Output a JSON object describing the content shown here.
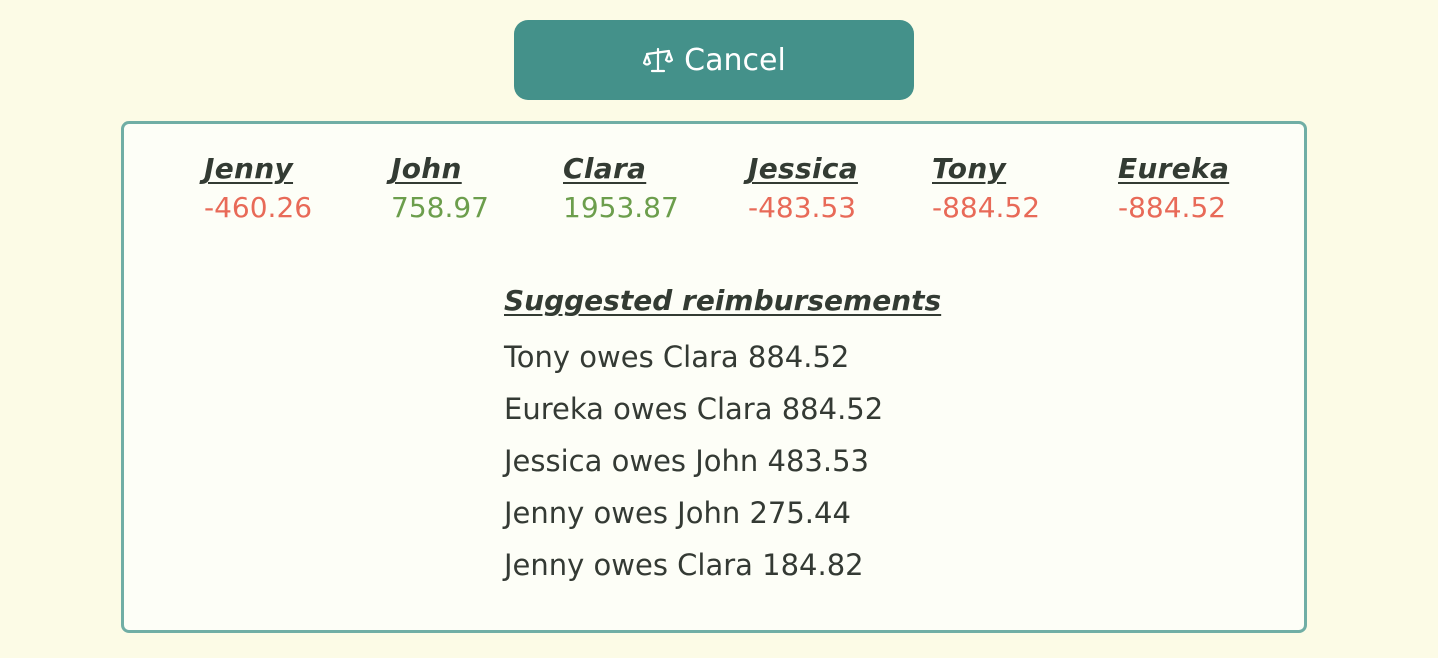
{
  "cancel_button": {
    "label": "Cancel",
    "icon": "balance-scale-icon"
  },
  "balances": [
    {
      "name": "Jenny",
      "amount": "-460.26",
      "sign": "negative"
    },
    {
      "name": "John",
      "amount": "758.97",
      "sign": "positive"
    },
    {
      "name": "Clara",
      "amount": "1953.87",
      "sign": "positive"
    },
    {
      "name": "Jessica",
      "amount": "-483.53",
      "sign": "negative"
    },
    {
      "name": "Tony",
      "amount": "-884.52",
      "sign": "negative"
    },
    {
      "name": "Eureka",
      "amount": "-884.52",
      "sign": "negative"
    }
  ],
  "reimbursements": {
    "heading": "Suggested reimbursements",
    "items": [
      "Tony owes Clara 884.52",
      "Eureka owes Clara 884.52",
      "Jessica owes John 483.53",
      "Jenny owes John 275.44",
      "Jenny owes Clara 184.82"
    ]
  },
  "colors": {
    "background": "#fcfbe6",
    "accent": "#44918a",
    "panel_border": "#70aea5",
    "negative": "#e86a58",
    "positive": "#6c9e4c",
    "text": "#333b33"
  }
}
